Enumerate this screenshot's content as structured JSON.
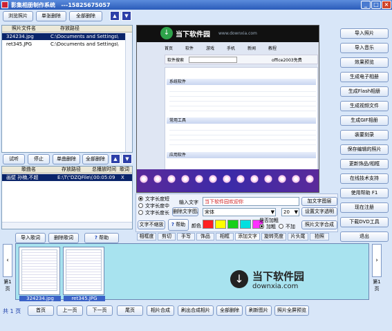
{
  "window": {
    "title": "影集相册制作系统",
    "subtitle": "---15825675057",
    "min": "_",
    "max": "□",
    "close": "×"
  },
  "toolbar": {
    "browse": "浏览照片",
    "delete_one": "单张删除",
    "delete_all": "全部删除"
  },
  "photo_list": {
    "col_name": "照片文件名",
    "col_path": "存放路径",
    "rows": [
      {
        "name": "324234.jpg",
        "path": "C:\\Documents and Settings\\"
      },
      {
        "name": "ret345.JPG",
        "path": "C:\\Documents and Settings\\"
      }
    ]
  },
  "music_toolbar": {
    "listen": "试听",
    "stop": "停止",
    "delete_one": "单曲删除",
    "delete_all": "全部删除"
  },
  "music_list": {
    "col_name": "歌曲名",
    "col_path": "存放路径",
    "col_time": "总播放时间",
    "col_lyrics": "歌词",
    "rows": [
      {
        "name": "画壁 孙楠,不超",
        "path": "E:\\T\\\"DZQFile\\(",
        "time": "00:05:09",
        "lyrics": "X"
      }
    ]
  },
  "lyrics_bar": {
    "import": "导入歌词",
    "delete": "删除歌词",
    "help": "帮助"
  },
  "preview": {
    "brand": "当下软件园",
    "brand_url": "www.downxia.com",
    "search_label": "软件搜索",
    "search_value": "office2003免费",
    "nav_items": [
      "首页",
      "软件",
      "游戏",
      "手机",
      "新闻",
      "教程"
    ],
    "section1": "系统软件",
    "section2": "常用工具",
    "section3": "应用软件"
  },
  "text_opts": {
    "len_short": "文字长度短",
    "len_mid": "文字长度中",
    "len_long": "文字长度长",
    "input_label": "输入文字",
    "input_value": "当下软件园欢迎你",
    "add_to_pic": "加文字图层",
    "del_layer": "删除文字图层",
    "font": "宋体",
    "set_transparent": "设置文字透明",
    "size": "20",
    "no_scale": "文字不缩放",
    "help": "帮助",
    "color_label": "颜色",
    "bold_label": "是否加粗",
    "bold": "加粗",
    "no_bold": "不加",
    "compose": "照片文字合成",
    "colors": [
      "#ff2020",
      "#ffff00",
      "#18d018",
      "#00e0e0",
      "#ff30ff"
    ]
  },
  "tabs": [
    "相框度",
    "剪切",
    "手写",
    "饰品",
    "相框",
    "添加文字",
    "旋转亮度",
    "片头尾",
    "拍照"
  ],
  "right_buttons": [
    "导入照片",
    "导入音乐",
    "效果预览",
    "生成电子相册",
    "生成Flash相册",
    "生成视频文件",
    "生成GIF相册",
    "装要刻录",
    "保存编辑的照片",
    "更新饰品/相框",
    "在线技术支持",
    "使用帮助  F1",
    "现在注册",
    "下载DVD工具",
    "退出"
  ],
  "thumbs": [
    {
      "label": "324234.jpg"
    },
    {
      "label": "ret345.JPG"
    }
  ],
  "page_side": {
    "left": "第1页",
    "right": "第1页"
  },
  "watermark": {
    "brand": "当下软件园",
    "url": "downxia.com"
  },
  "bottom": {
    "total": "共",
    "total_num": "1",
    "total_unit": "页",
    "buttons": [
      "首页",
      "上一页",
      "下一页",
      "尾页",
      "相片合成",
      "刷出合成相片",
      "全部删除",
      "刷新图片",
      "照片全屏预览"
    ]
  }
}
